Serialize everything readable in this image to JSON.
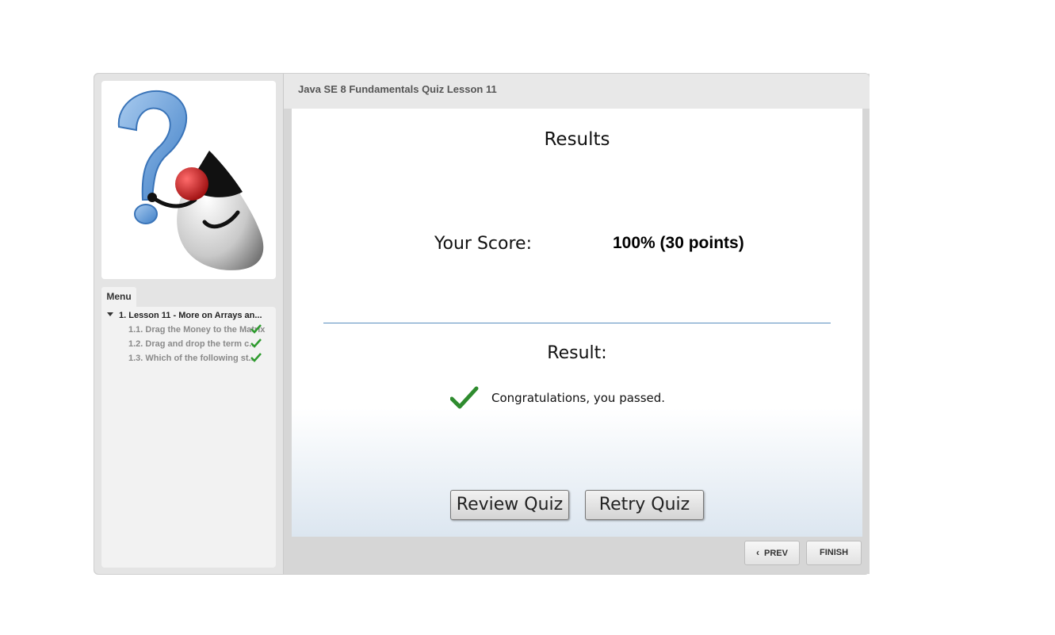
{
  "header": {
    "title": "Java SE 8 Fundamentals Quiz Lesson 11"
  },
  "sidebar": {
    "menu_tab": "Menu",
    "items": [
      {
        "label": "1. Lesson 11 - More on Arrays an..."
      },
      {
        "label": "1.1. Drag the Money to the Matrix",
        "completed": true
      },
      {
        "label": "1.2. Drag and drop the term c...",
        "completed": true
      },
      {
        "label": "1.3. Which of the following st...",
        "completed": true
      }
    ]
  },
  "results": {
    "title": "Results",
    "score_label": "Your Score:",
    "score_value": "100% (30 points)",
    "result_label": "Result:",
    "message": "Congratulations, you passed."
  },
  "buttons": {
    "review": "Review Quiz",
    "retry": "Retry Quiz",
    "prev": "PREV",
    "finish": "FINISH"
  },
  "colors": {
    "check_green": "#2e8b2e",
    "divider_blue": "#5a8fc0",
    "question_mark_blue": "#6fa3dc",
    "nose_red": "#c0191b"
  },
  "icons": {
    "logo": "duke-question-mark-logo",
    "pass": "green-checkmark-icon",
    "menu_expand": "caret-down-icon",
    "prev": "chevron-left-icon"
  }
}
